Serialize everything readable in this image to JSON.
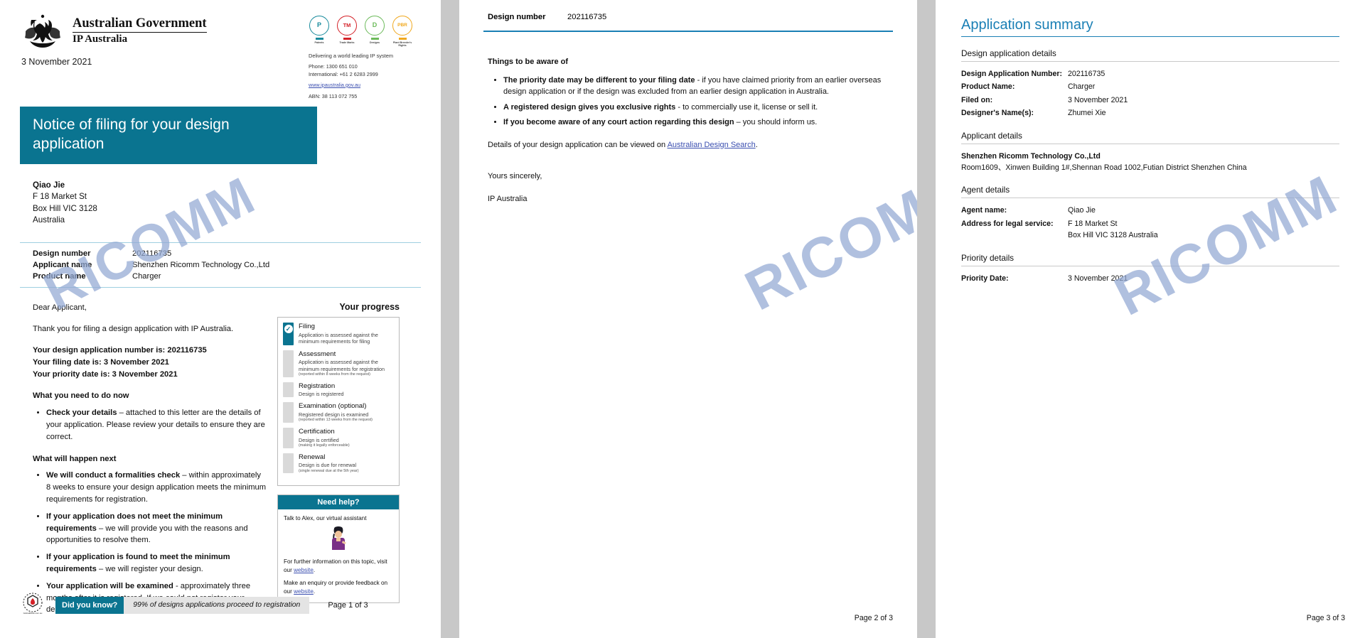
{
  "brand": {
    "accent": "#0a7490",
    "link": "#3b4fb0",
    "title_blue": "#1a7fb5",
    "watermark_color": "#93a9d4"
  },
  "watermark": {
    "text": "RICOMM"
  },
  "page1": {
    "header": {
      "gov_line1": "Australian Government",
      "gov_line2": "IP Australia",
      "date": "3 November 2021",
      "ip_icons": [
        {
          "letter": "P",
          "caption": "Patents",
          "color": "#178a9c"
        },
        {
          "letter": "TM",
          "caption": "Trade Marks",
          "color": "#d42027"
        },
        {
          "letter": "D",
          "caption": "Designs",
          "color": "#6cba5a"
        },
        {
          "letter": "PBR",
          "caption": "Plant Breeder's Rights",
          "color": "#f0a81e"
        }
      ],
      "tagline": "Delivering a world leading IP system",
      "phone_label": "Phone:",
      "phone": "1300 651 010",
      "intl_label": "International:",
      "intl": "+61 2 6283 2999",
      "website": "www.ipaustralia.gov.au",
      "abn_label": "ABN:",
      "abn": "38 113 072 755"
    },
    "title": "Notice of filing for your design application",
    "address": {
      "name": "Qiao Jie",
      "lines": [
        "F 18 Market St",
        "Box Hill VIC 3128",
        "Australia"
      ]
    },
    "key_table": [
      {
        "key": "Design number",
        "value": "202116735"
      },
      {
        "key": "Applicant name",
        "value": "Shenzhen Ricomm Technology Co.,Ltd"
      },
      {
        "key": "Product name",
        "value": "Charger"
      }
    ],
    "body": {
      "salutation": "Dear Applicant,",
      "thanks": "Thank you for filing a design application with IP Australia.",
      "facts": [
        "Your design application number is: 202116735",
        "Your filing date is: 3 November 2021",
        "Your priority date is: 3 November 2021"
      ],
      "todo_heading": "What you need to do now",
      "todo_items": [
        {
          "bold": "Check your details",
          "rest": " – attached to this letter are the details of your application. Please review your details to ensure they are correct."
        }
      ],
      "next_heading": "What will happen next",
      "next_items": [
        {
          "bold": "We will conduct a formalities check",
          "rest": " – within approximately 8 weeks to ensure your design application meets the minimum requirements for registration."
        },
        {
          "bold": "If your application does not meet the minimum requirements",
          "rest": " – we will provide you with the reasons and opportunities to resolve them."
        },
        {
          "bold": "If your application is found to meet the minimum requirements",
          "rest": " – we will register your design."
        },
        {
          "bold": "Your application will be examined",
          "rest": " - approximately three months after it is registered. If we could not register your design and you have paid an examination fee we will refund it."
        }
      ]
    },
    "progress": {
      "title": "Your progress",
      "steps": [
        {
          "name": "Filing",
          "desc": "Application is assessed against the minimum requirements for filing",
          "sub": "",
          "done": true
        },
        {
          "name": "Assessment",
          "desc": "Application is assessed against the minimum requirements for registration",
          "sub": "(reported within 8 weeks from the request)",
          "done": false
        },
        {
          "name": "Registration",
          "desc": "Design is registered",
          "sub": "",
          "done": false
        },
        {
          "name": "Examination (optional)",
          "desc": "Registered design is examined",
          "sub": "(reported within 13 weeks from the request)",
          "done": false
        },
        {
          "name": "Certification",
          "desc": "Design is certified",
          "sub": "(making it legally enforceable)",
          "done": false
        },
        {
          "name": "Renewal",
          "desc": "Design is due for renewal",
          "sub": "(single renewal due at the 5th year)",
          "done": false
        }
      ]
    },
    "help": {
      "heading": "Need help?",
      "line1": "Talk to Alex, our virtual assistant",
      "line2_pre": "For further information on this topic, visit our ",
      "line2_link": "website",
      "line2_post": ".",
      "line3_pre": "Make an enquiry or provide feedback on our ",
      "line3_link": "website",
      "line3_post": "."
    },
    "footer": {
      "dyk_label": "Did you know?",
      "dyk_value": "99% of designs applications proceed to registration",
      "page_number": "Page 1 of 3"
    }
  },
  "page2": {
    "head": {
      "key": "Design number",
      "value": "202116735"
    },
    "aware_heading": "Things to be aware of",
    "aware_items": [
      {
        "bold": "The priority date may be different to your filing date",
        "rest": " - if you have claimed priority from an earlier overseas design application or if the design was excluded from an earlier design application in Australia."
      },
      {
        "bold": "A registered design gives you exclusive rights",
        "rest": " - to commercially use it, license or sell it."
      },
      {
        "bold": "If you become aware of any court action regarding this design",
        "rest": " – you should inform us."
      }
    ],
    "details_pre": "Details of your design application can be viewed on ",
    "details_link": "Australian Design Search",
    "details_post": ".",
    "sign_off": "Yours sincerely,",
    "signer": "IP Australia",
    "page_number": "Page 2 of 3"
  },
  "page3": {
    "title": "Application summary",
    "sections": [
      {
        "heading": "Design application details",
        "rows": [
          {
            "key": "Design Application Number:",
            "value": "202116735"
          },
          {
            "key": "Product Name:",
            "value": "Charger"
          },
          {
            "key": "Filed on:",
            "value": "3 November 2021"
          },
          {
            "key": "Designer's Name(s):",
            "value": "Zhumei Xie"
          }
        ]
      },
      {
        "heading": "Applicant details",
        "block_bold": "Shenzhen Ricomm Technology Co.,Ltd",
        "block_text": "Room1609、Xinwen Building 1#,Shennan Road 1002,Futian District Shenzhen  China"
      },
      {
        "heading": "Agent details",
        "rows": [
          {
            "key": "Agent name:",
            "value": "Qiao Jie"
          },
          {
            "key": "Address for legal service:",
            "value": "F 18 Market St\nBox Hill VIC 3128 Australia"
          }
        ]
      },
      {
        "heading": "Priority details",
        "rows": [
          {
            "key": "Priority Date:",
            "value": "3 November 2021"
          }
        ]
      }
    ],
    "page_number": "Page 3 of 3"
  }
}
